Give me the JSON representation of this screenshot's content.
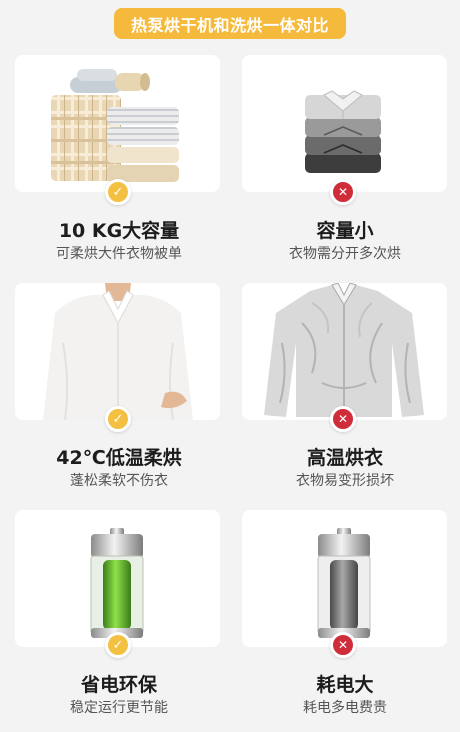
{
  "banner": {
    "title": "热泵烘干机和洗烘一体对比"
  },
  "rows": [
    {
      "left": {
        "heading": "10 KG大容量",
        "subtitle": "可柔烘大件衣物被单",
        "status": "check"
      },
      "right": {
        "heading": "容量小",
        "subtitle": "衣物需分开多次烘",
        "status": "cross"
      }
    },
    {
      "left": {
        "heading": "42℃低温柔烘",
        "subtitle": "蓬松柔软不伤衣",
        "status": "check"
      },
      "right": {
        "heading": "高温烘衣",
        "subtitle": "衣物易变形损坏",
        "status": "cross"
      }
    },
    {
      "left": {
        "heading": "省电环保",
        "subtitle": "稳定运行更节能",
        "status": "check"
      },
      "right": {
        "heading": "耗电大",
        "subtitle": "耗电多电费贵",
        "status": "cross"
      }
    }
  ],
  "icons": {
    "check": "checkmark-icon",
    "cross": "cross-icon"
  },
  "colors": {
    "banner": "#f5b93b",
    "check": "#f4c042",
    "cross": "#cf2d3a",
    "battery_good": "#7bd33a"
  }
}
